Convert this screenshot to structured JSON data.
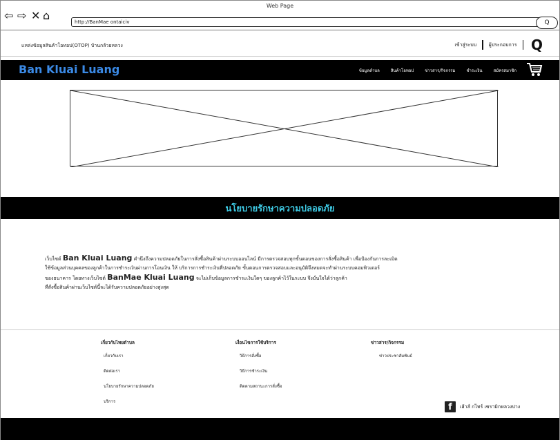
{
  "window": {
    "title": "Web Page",
    "url": "http://BanMae ontaiciv",
    "search_label": "Q"
  },
  "top": {
    "tagline": "แหล่งข้อมูลสินค้าโอทอป(OTOP) บ้านกล้วยหลวง",
    "login": "เข้าสู่ระบบ",
    "operator": "ผู้ประกอบการ",
    "search_glyph": "Q"
  },
  "header": {
    "brand": "Ban Kluai Luang",
    "menu": [
      "ข้อมูลตำบล",
      "สินค้าโอทอป",
      "ข่าวสาร/กิจกรรม",
      "ชำระเงิน",
      "สมัครสมาชิก"
    ],
    "cart_icon": "cart-icon"
  },
  "banner": {
    "title": "นโยบายรักษาความปลอดภัย"
  },
  "policy": {
    "prefix": "เว็บไซต์",
    "brand": "Ban Kluai Luang",
    "line1": "คำนึงถึงความปลอดภัยในการสั่งซื้อสินค้าผ่านระบบออนไลน์ มีการตรวจสอบทุกขั้นตอนของการสั่งซื้อสินค้า เพื่อป้องกันการละเมิด",
    "line2": "ใช้ข้อมูลส่วนบุคคลของลูกค้าในการชำระเงินผ่านการโอนเงิน ให้ บริการการชำระเงินที่ปลอดภัย ขั้นตอนการตรวจสอบและอนุมัติจึงหมดจะทำผ่านระบบคอมพิวเตอร์",
    "line3a": "ของธนาคาร โดยทางเว็บไซต์",
    "brand2": "BanMae Kluai Luang",
    "line3b": "จะไม่เก็บข้อมูลการชำระเงินใดๆ ของลูกค้าไว้ในระบบ จึงมั่นใจได้ว่าลูกค้า",
    "line4": "ที่สั่งซื้อสินค้าผ่านเว็บไซต์นี้จะได้รับความปลอดภัยอย่างสูงสุด"
  },
  "footer": {
    "col1": {
      "heading": "เกี่ยวกับไทยตำบล",
      "items": [
        "เกี่ยวกับเรา",
        "ติดต่อเรา",
        "นโยบายรักษาความปลอดภัย",
        "บริการ"
      ]
    },
    "col2": {
      "heading": "เงื่อนไขการใช้บริการ",
      "items": [
        "วิธีการสั่งซื้อ",
        "วิธีการชำระเงิน",
        "ติดตามสถานะการสั่งซื้อ"
      ]
    },
    "col3": {
      "heading": "ข่าวสาร/กิจกรรม",
      "items": [
        "ข่าวประชาสัมพันธ์"
      ]
    },
    "facebook": "เฮ้าส์ กไทร์ เซรามิกหลวงปาง"
  }
}
